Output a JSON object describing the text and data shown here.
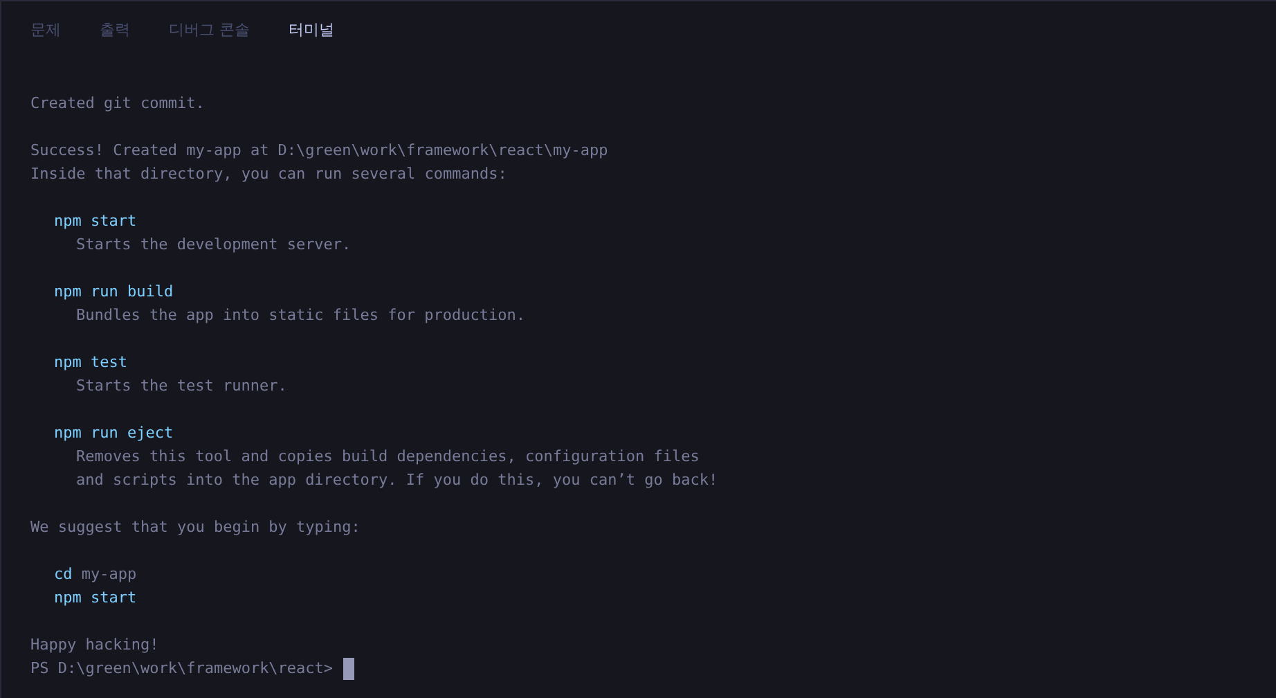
{
  "tabs": [
    {
      "label": "문제",
      "selected": false
    },
    {
      "label": "출력",
      "selected": false
    },
    {
      "label": "디버그 콘솔",
      "selected": false
    },
    {
      "label": "터미널",
      "selected": true
    }
  ],
  "terminal": {
    "blocks": [
      [
        {
          "kind": "plain",
          "segments": [
            {
              "text": "Created git commit.",
              "kind": "output"
            }
          ]
        }
      ],
      [
        {
          "kind": "plain",
          "segments": [
            {
              "text": "Success! Created my-app at D:\\green\\work\\framework\\react\\my-app",
              "kind": "output"
            }
          ]
        },
        {
          "kind": "plain",
          "segments": [
            {
              "text": "Inside that directory, you can run several commands:",
              "kind": "output"
            }
          ]
        }
      ],
      [
        {
          "kind": "command",
          "segments": [
            {
              "text": "npm start",
              "kind": "command"
            }
          ]
        },
        {
          "kind": "description",
          "segments": [
            {
              "text": "Starts the development server.",
              "kind": "output"
            }
          ]
        }
      ],
      [
        {
          "kind": "command",
          "segments": [
            {
              "text": "npm run build",
              "kind": "command"
            }
          ]
        },
        {
          "kind": "description",
          "segments": [
            {
              "text": "Bundles the app into static files for production.",
              "kind": "output"
            }
          ]
        }
      ],
      [
        {
          "kind": "command",
          "segments": [
            {
              "text": "npm test",
              "kind": "command"
            }
          ]
        },
        {
          "kind": "description",
          "segments": [
            {
              "text": "Starts the test runner.",
              "kind": "output"
            }
          ]
        }
      ],
      [
        {
          "kind": "command",
          "segments": [
            {
              "text": "npm run eject",
              "kind": "command"
            }
          ]
        },
        {
          "kind": "description",
          "segments": [
            {
              "text": "Removes this tool and copies build dependencies, configuration files",
              "kind": "output"
            }
          ]
        },
        {
          "kind": "description",
          "segments": [
            {
              "text": "and scripts into the app directory. If you do this, you can’t go back!",
              "kind": "output"
            }
          ]
        }
      ],
      [
        {
          "kind": "plain",
          "segments": [
            {
              "text": "We suggest that you begin by typing:",
              "kind": "output"
            }
          ]
        }
      ],
      [
        {
          "kind": "command",
          "segments": [
            {
              "text": "cd",
              "kind": "command"
            },
            {
              "text": "my-app",
              "kind": "output"
            }
          ]
        },
        {
          "kind": "command",
          "segments": [
            {
              "text": "npm start",
              "kind": "command"
            }
          ]
        }
      ],
      [
        {
          "kind": "plain",
          "segments": [
            {
              "text": "Happy hacking!",
              "kind": "output"
            }
          ]
        },
        {
          "kind": "prompt",
          "segments": [
            {
              "text": "PS D:\\green\\work\\framework\\react>",
              "kind": "output"
            }
          ]
        }
      ]
    ]
  }
}
